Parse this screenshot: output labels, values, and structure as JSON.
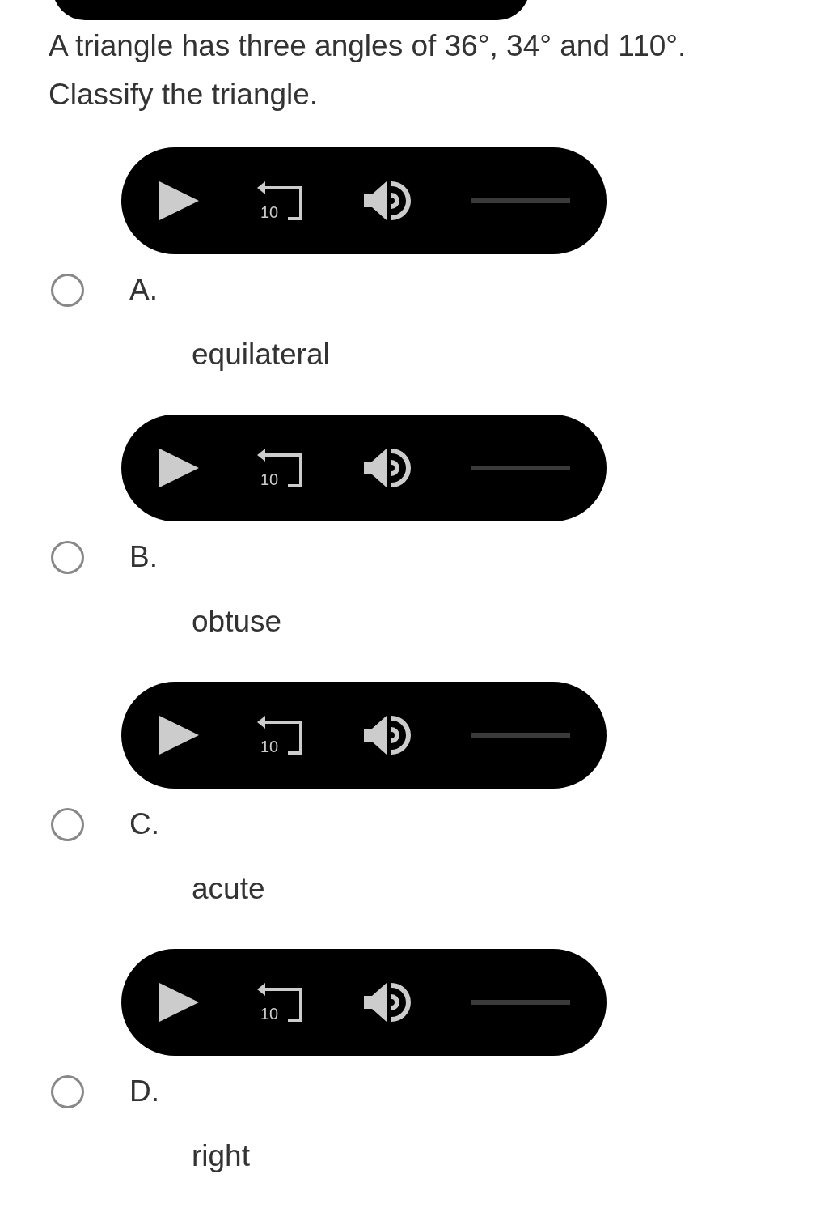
{
  "question": "A triangle has three angles of 36°, 34° and 110°. Classify the triangle.",
  "options": [
    {
      "letter": "A.",
      "text": "equilateral",
      "selected": false,
      "player": {
        "rewind_label": "10"
      }
    },
    {
      "letter": "B.",
      "text": "obtuse",
      "selected": false,
      "player": {
        "rewind_label": "10"
      }
    },
    {
      "letter": "C.",
      "text": "acute",
      "selected": false,
      "player": {
        "rewind_label": "10"
      }
    },
    {
      "letter": "D.",
      "text": "right",
      "selected": false,
      "player": {
        "rewind_label": "10"
      }
    }
  ]
}
